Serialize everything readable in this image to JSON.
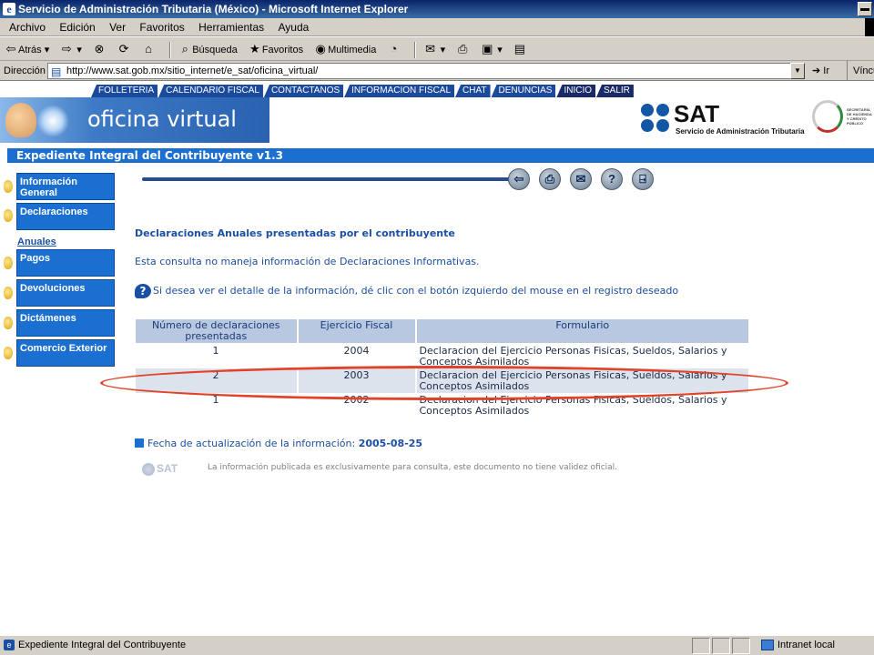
{
  "window": {
    "title": "Servicio de Administración Tributaria (México) - Microsoft Internet Explorer"
  },
  "menubar": [
    "Archivo",
    "Edición",
    "Ver",
    "Favoritos",
    "Herramientas",
    "Ayuda"
  ],
  "toolbar": {
    "back": "Atrás",
    "search": "Búsqueda",
    "favorites": "Favoritos",
    "multimedia": "Multimedia"
  },
  "addressbar": {
    "label": "Dirección",
    "url": "http://www.sat.gob.mx/sitio_internet/e_sat/oficina_virtual/",
    "go": "Ir",
    "links": "Vínculos"
  },
  "site": {
    "nav": [
      "FOLLETERIA",
      "CALENDARIO FISCAL",
      "CONTACTANOS",
      "INFORMACION FISCAL",
      "CHAT",
      "DENUNCIAS",
      "INICIO",
      "SALIR"
    ],
    "banner_text": "oficina virtual",
    "logo_word": "SAT",
    "logo_sub": "Servicio de Administración Tributaria",
    "hacienda_text": "SECRETARÍA DE HACIENDA Y CRÉDITO PÚBLICO"
  },
  "section_title": "Expediente Integral del Contribuyente v1.3",
  "sidebar": {
    "items": [
      {
        "label": "Información General"
      },
      {
        "label": "Declaraciones"
      },
      {
        "label": "Pagos"
      },
      {
        "label": "Devoluciones"
      },
      {
        "label": "Dictámenes"
      },
      {
        "label": "Comercio Exterior"
      }
    ],
    "sub_item": "Anuales"
  },
  "content": {
    "title": "Declaraciones Anuales presentadas por el contribuyente",
    "note": "Esta consulta no maneja información de Declaraciones Informativas.",
    "help": "Si desea ver el detalle de la información, dé clic con el botón izquierdo del mouse en el registro deseado",
    "table": {
      "headers": [
        "Número de declaraciones presentadas",
        "Ejercicio Fiscal",
        "Formulario"
      ],
      "rows": [
        {
          "count": "1",
          "year": "2004",
          "form": "Declaracion del Ejercicio Personas Fisicas, Sueldos, Salarios y Conceptos Asimilados"
        },
        {
          "count": "2",
          "year": "2003",
          "form": "Declaracion del Ejercicio Personas Fisicas, Sueldos, Salarios y Conceptos Asimilados"
        },
        {
          "count": "1",
          "year": "2002",
          "form": "Declaracion del Ejercicio Personas Fisicas, Sueldos, Salarios y Conceptos Asimilados"
        }
      ]
    },
    "update_label": "Fecha de actualización de la información:",
    "update_date": "2005-08-25",
    "disclaimer": "La información publicada es exclusivamente para consulta, este documento no tiene validez oficial.",
    "footer_logo": "SAT"
  },
  "statusbar": {
    "text": "Expediente Integral del Contribuyente",
    "zone": "Intranet local"
  },
  "colors": {
    "accent": "#1b6fd0",
    "highlight_ring": "#e0432a"
  }
}
